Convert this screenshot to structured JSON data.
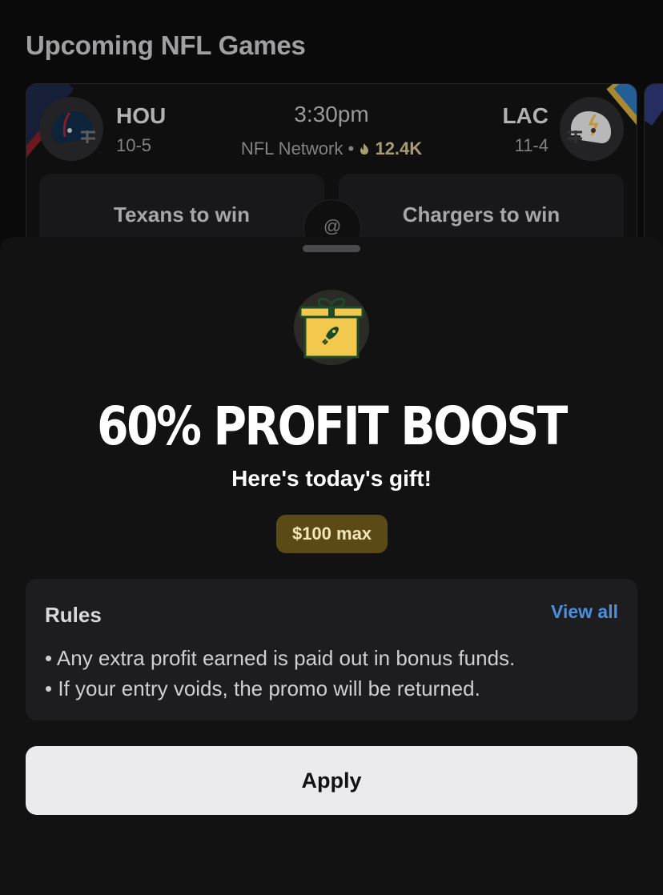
{
  "section_title": "Upcoming NFL Games",
  "game": {
    "home": {
      "abbr": "HOU",
      "record": "10-5",
      "pick_label": "Texans to win",
      "color": "#03202F"
    },
    "away": {
      "abbr": "LAC",
      "record": "11-4",
      "pick_label": "Chargers to win",
      "color": "#0080C6"
    },
    "time": "3:30pm",
    "network": "NFL Network",
    "separator": "•",
    "popularity": "12.4K",
    "at_symbol": "@"
  },
  "promo": {
    "icon": "gift-rocket-icon",
    "title": "60% PROFIT BOOST",
    "subtitle": "Here's today's gift!",
    "max_label": "$100 max",
    "accent_color": "#F2C94C"
  },
  "rules": {
    "title": "Rules",
    "view_all": "View all",
    "items": [
      "• Any extra profit earned is paid out in bonus funds.",
      "• If your entry voids, the promo will be returned."
    ]
  },
  "apply_label": "Apply"
}
